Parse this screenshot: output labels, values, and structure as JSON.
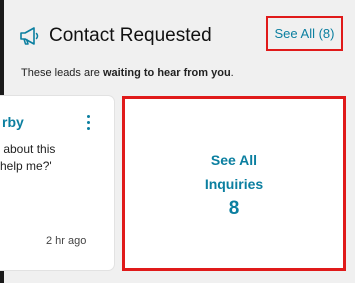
{
  "header": {
    "title": "Contact Requested",
    "see_all_label": "See All (8)"
  },
  "subtitle": {
    "prefix": "These leads are ",
    "emphasis": "waiting to hear from you",
    "suffix": "."
  },
  "lead_card": {
    "name_partial": "rby",
    "message_partial": " about this\nhelp me?'",
    "time": "2 hr ago"
  },
  "inquiries_card": {
    "label": "See All\nInquiries",
    "count": "8"
  },
  "colors": {
    "accent": "#0b7fa0",
    "highlight_border": "#e01a1a",
    "background": "#f0f0f0"
  },
  "icons": {
    "header_icon": "megaphone-icon",
    "menu_icon": "kebab-menu-icon"
  }
}
